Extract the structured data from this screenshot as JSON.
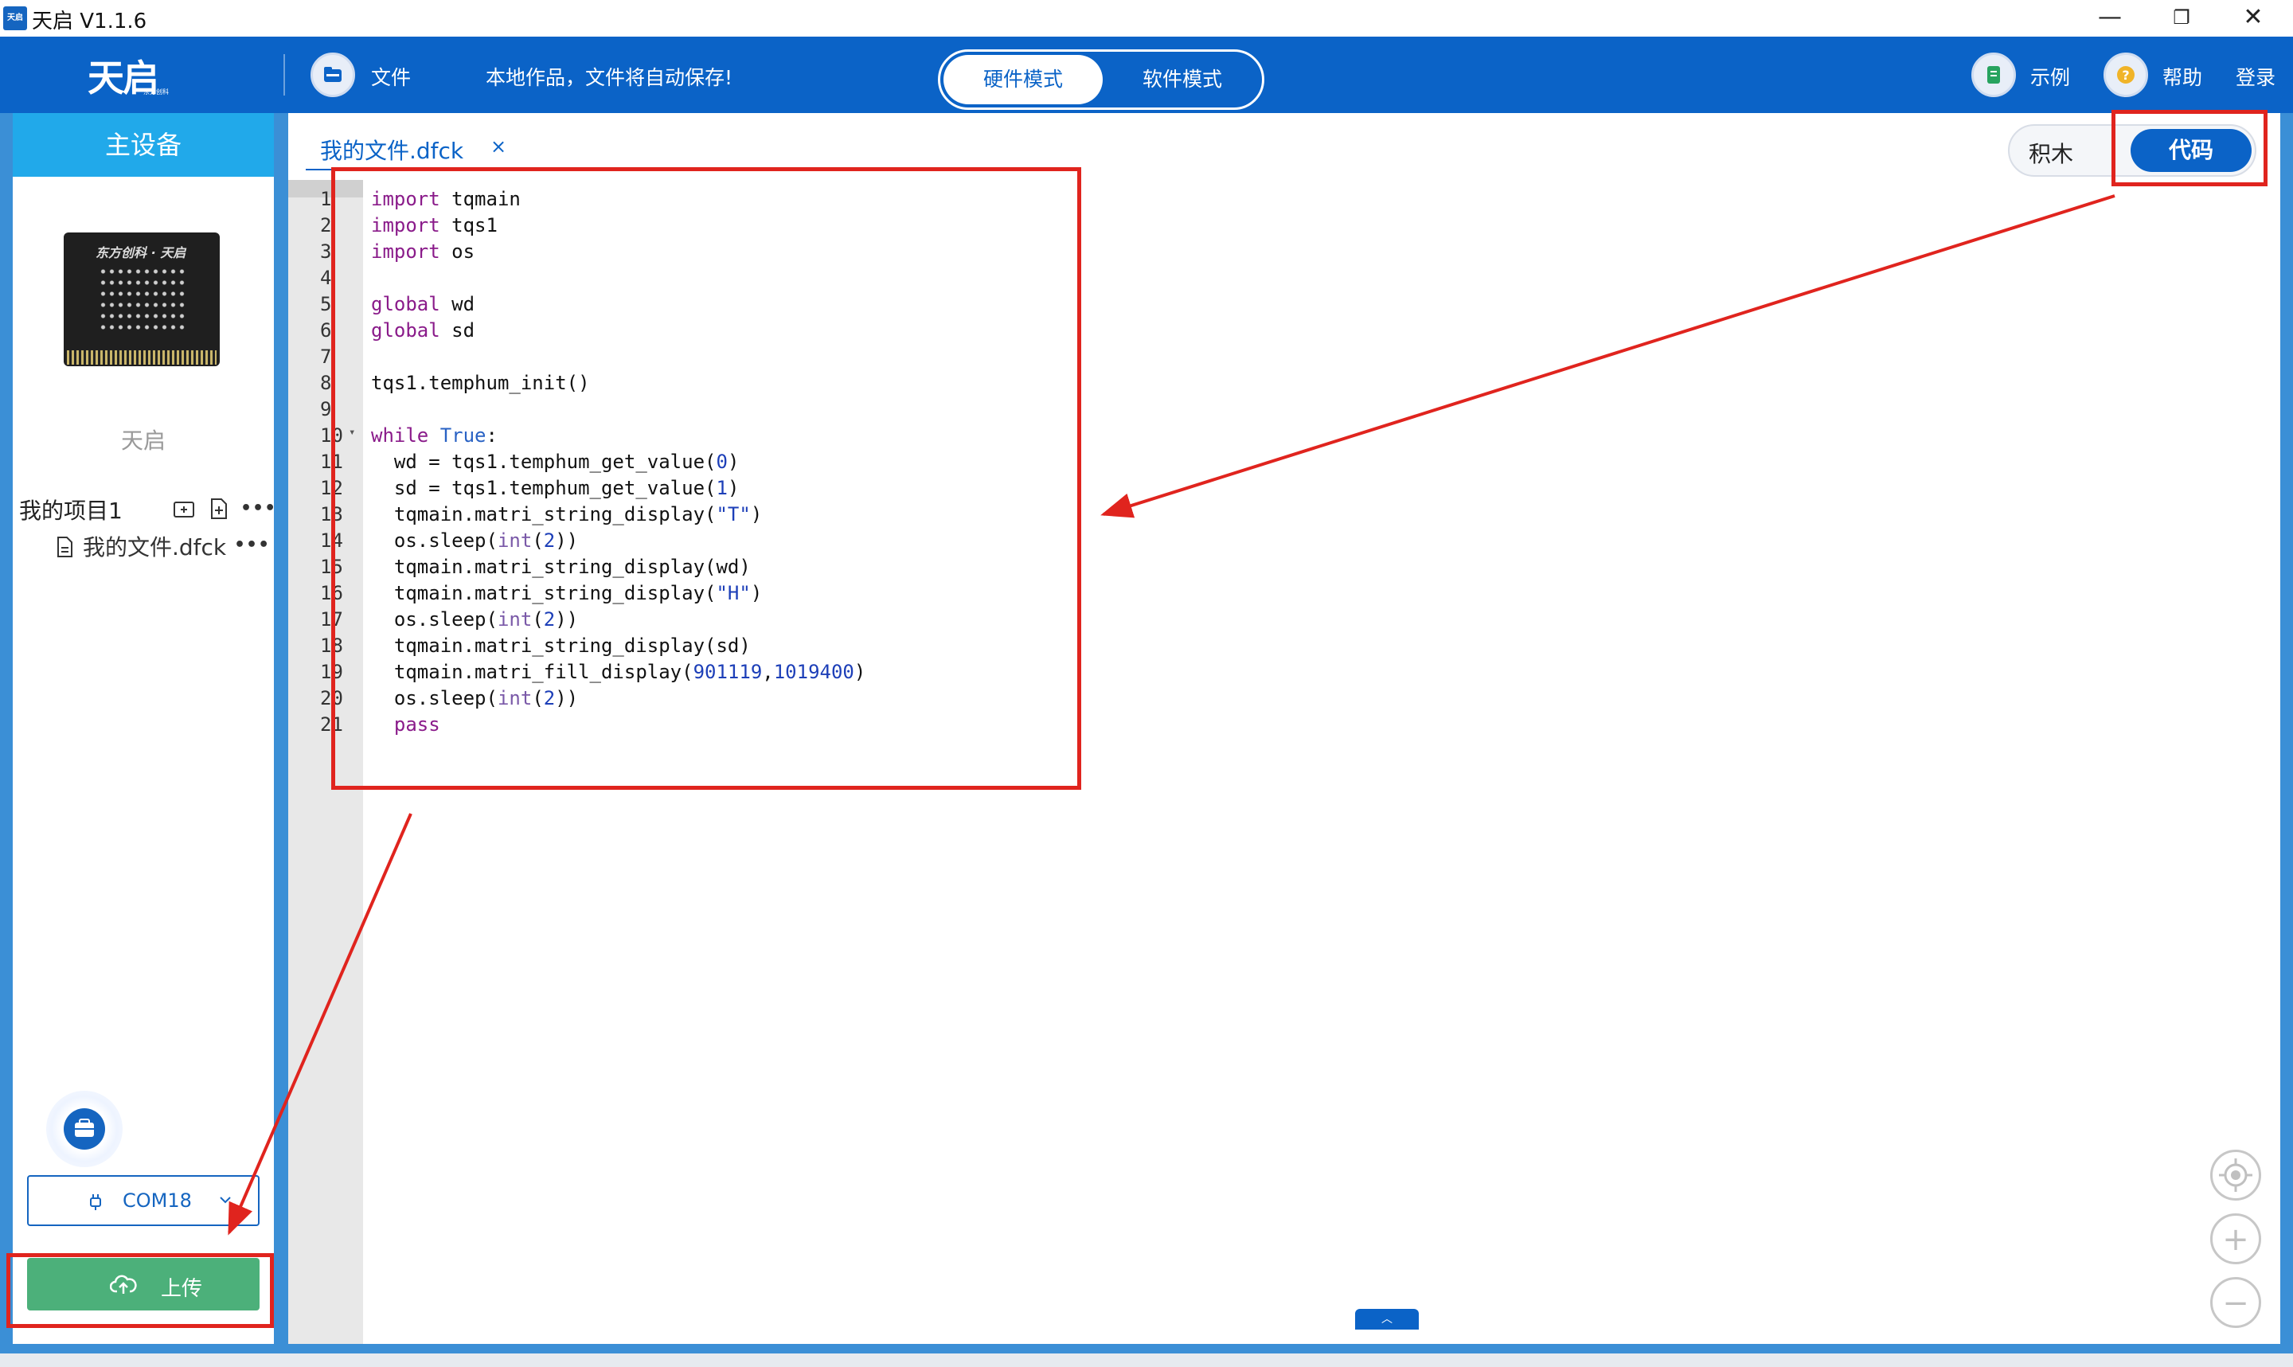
{
  "window": {
    "app_icon_text": "天启",
    "title": "天启 V1.1.6",
    "minimize": "—",
    "restore": "❐",
    "close": "✕"
  },
  "header": {
    "logo_text": "天启",
    "logo_sub": "东方创科",
    "file_label": "文件",
    "autosave_notice": "本地作品，文件将自动保存!",
    "mode_hardware": "硬件模式",
    "mode_software": "软件模式",
    "examples_label": "示例",
    "help_label": "帮助",
    "login_label": "登录"
  },
  "sidebar": {
    "title": "主设备",
    "device_brand": "东方创科 · 天启",
    "device_name": "天启",
    "project_name": "我的项目1",
    "file_name": "我的文件.dfck",
    "more": "•••",
    "port": "COM18",
    "upload_label": "上传"
  },
  "editor": {
    "tab_name": "我的文件.dfck",
    "tab_close": "×",
    "view_blocks": "积木",
    "view_code": "代码",
    "collapse": "︿",
    "zoom_in": "+",
    "zoom_out": "−",
    "lines": [
      {
        "n": "1",
        "tokens": [
          [
            "kw",
            "import"
          ],
          [
            "",
            " tqmain"
          ]
        ]
      },
      {
        "n": "2",
        "tokens": [
          [
            "kw",
            "import"
          ],
          [
            "",
            " tqs1"
          ]
        ]
      },
      {
        "n": "3",
        "tokens": [
          [
            "kw",
            "import"
          ],
          [
            "",
            " os"
          ]
        ]
      },
      {
        "n": "4",
        "tokens": []
      },
      {
        "n": "5",
        "tokens": [
          [
            "kw",
            "global"
          ],
          [
            "",
            " wd"
          ]
        ]
      },
      {
        "n": "6",
        "tokens": [
          [
            "kw",
            "global"
          ],
          [
            "",
            " sd"
          ]
        ]
      },
      {
        "n": "7",
        "tokens": []
      },
      {
        "n": "8",
        "tokens": [
          [
            "",
            "tqs1.temphum_init()"
          ]
        ]
      },
      {
        "n": "9",
        "tokens": []
      },
      {
        "n": "10",
        "fold": true,
        "tokens": [
          [
            "kw",
            "while"
          ],
          [
            "",
            " "
          ],
          [
            "bool",
            "True"
          ],
          [
            "",
            ":"
          ]
        ]
      },
      {
        "n": "11",
        "tokens": [
          [
            "",
            "  wd = tqs1.temphum_get_value("
          ],
          [
            "num",
            "0"
          ],
          [
            "",
            ")"
          ]
        ]
      },
      {
        "n": "12",
        "tokens": [
          [
            "",
            "  sd = tqs1.temphum_get_value("
          ],
          [
            "num",
            "1"
          ],
          [
            "",
            ")"
          ]
        ]
      },
      {
        "n": "13",
        "tokens": [
          [
            "",
            "  tqmain.matri_string_display("
          ],
          [
            "str",
            "\"T\""
          ],
          [
            "",
            ")"
          ]
        ]
      },
      {
        "n": "14",
        "tokens": [
          [
            "",
            "  os.sleep("
          ],
          [
            "bi",
            "int"
          ],
          [
            "",
            "("
          ],
          [
            "num",
            "2"
          ],
          [
            "",
            "))"
          ]
        ]
      },
      {
        "n": "15",
        "tokens": [
          [
            "",
            "  tqmain.matri_string_display(wd)"
          ]
        ]
      },
      {
        "n": "16",
        "tokens": [
          [
            "",
            "  tqmain.matri_string_display("
          ],
          [
            "str",
            "\"H\""
          ],
          [
            "",
            ")"
          ]
        ]
      },
      {
        "n": "17",
        "tokens": [
          [
            "",
            "  os.sleep("
          ],
          [
            "bi",
            "int"
          ],
          [
            "",
            "("
          ],
          [
            "num",
            "2"
          ],
          [
            "",
            "))"
          ]
        ]
      },
      {
        "n": "18",
        "tokens": [
          [
            "",
            "  tqmain.matri_string_display(sd)"
          ]
        ]
      },
      {
        "n": "19",
        "tokens": [
          [
            "",
            "  tqmain.matri_fill_display("
          ],
          [
            "num",
            "901119"
          ],
          [
            "",
            ","
          ],
          [
            "num",
            "1019400"
          ],
          [
            "",
            ")"
          ]
        ]
      },
      {
        "n": "20",
        "tokens": [
          [
            "",
            "  os.sleep("
          ],
          [
            "bi",
            "int"
          ],
          [
            "",
            "("
          ],
          [
            "num",
            "2"
          ],
          [
            "",
            "))"
          ]
        ]
      },
      {
        "n": "21",
        "tokens": [
          [
            "",
            "  "
          ],
          [
            "kw",
            "pass"
          ]
        ]
      }
    ]
  },
  "colors": {
    "header_blue": "#0b63c7",
    "sidebar_head": "#21a9ea",
    "upload_green": "#4cb07a",
    "annotation_red": "#e0241e"
  },
  "icons": {
    "file": "folder-icon",
    "examples": "book-icon",
    "help": "question-icon",
    "upload": "cloud-upload-icon",
    "port": "usb-icon",
    "locate": "crosshair-icon"
  }
}
